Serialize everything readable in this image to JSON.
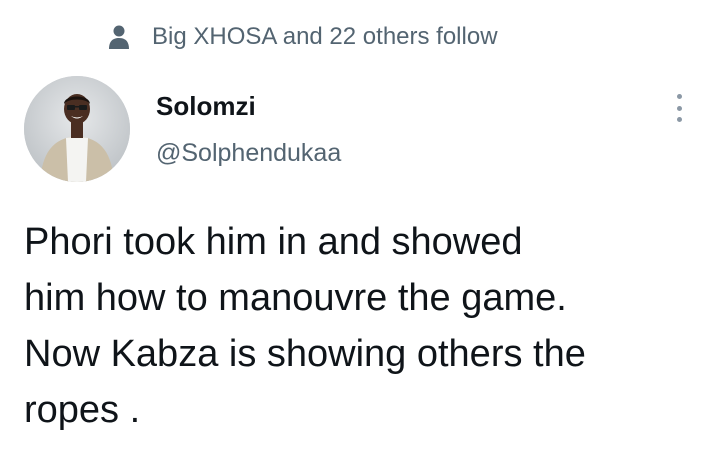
{
  "social_context": {
    "icon": "person-icon",
    "text": "Big XHOSA and 22 others follow"
  },
  "author": {
    "display_name": "Solomzi",
    "handle": "@Solphendukaa",
    "avatar": "avatar-photo"
  },
  "more_menu": {
    "icon": "more-vertical-icon"
  },
  "tweet": {
    "lines": [
      "Phori took him in and showed",
      "him how to manouvre the game.",
      "Now Kabza is showing others the",
      "ropes ."
    ]
  },
  "colors": {
    "text_primary": "#0f1419",
    "text_secondary": "#536471",
    "background": "#ffffff"
  }
}
